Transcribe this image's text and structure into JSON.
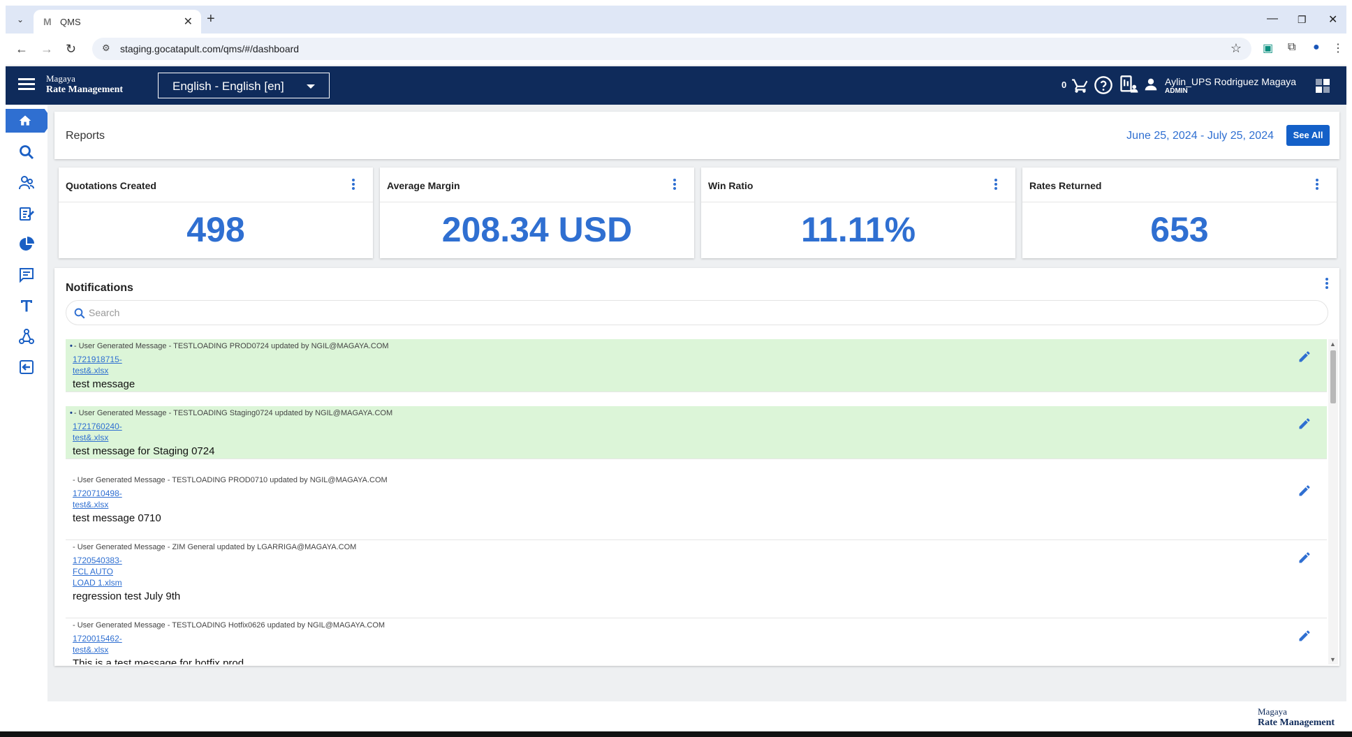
{
  "browser": {
    "tab_title": "QMS",
    "tab_favicon": "M",
    "url": "staging.gocatapult.com/qms/#/dashboard"
  },
  "header": {
    "brand_line1": "Magaya",
    "brand_line2": "Rate Management",
    "language": "English - English [en]",
    "cart_count": "0",
    "user_name": "Aylin_UPS Rodriguez Magaya",
    "user_role": "ADMIN"
  },
  "sidebar": {
    "items": [
      "home-icon",
      "search-icon",
      "users-icon",
      "edit-document-icon",
      "pie-chart-icon",
      "message-icon",
      "text-icon",
      "network-icon",
      "logout-icon"
    ]
  },
  "reports": {
    "title": "Reports",
    "date_range": "June 25, 2024 - July 25, 2024",
    "see_all_label": "See All"
  },
  "stats": [
    {
      "title": "Quotations Created",
      "value": "498"
    },
    {
      "title": "Average Margin",
      "value": "208.34 USD"
    },
    {
      "title": "Win Ratio",
      "value": "11.11%"
    },
    {
      "title": "Rates Returned",
      "value": "653"
    }
  ],
  "notifications": {
    "title": "Notifications",
    "search_placeholder": "Search",
    "items": [
      {
        "unread": true,
        "meta": "- User Generated Message - TESTLOADING PROD0724 updated by NGIL@MAGAYA.COM",
        "link_lines": [
          "1721918715-",
          "test&.xlsx"
        ],
        "message": "test message"
      },
      {
        "unread": true,
        "meta": "- User Generated Message - TESTLOADING Staging0724 updated by NGIL@MAGAYA.COM",
        "link_lines": [
          "1721760240-",
          "test&.xlsx"
        ],
        "message": "test message for Staging 0724"
      },
      {
        "unread": false,
        "meta": "- User Generated Message - TESTLOADING PROD0710 updated by NGIL@MAGAYA.COM",
        "link_lines": [
          "1720710498-",
          "test&.xlsx"
        ],
        "message": "test message 0710"
      },
      {
        "unread": false,
        "meta": "- User Generated Message - ZIM General updated by LGARRIGA@MAGAYA.COM",
        "link_lines": [
          "1720540383-",
          "FCL AUTO",
          "LOAD 1.xlsm"
        ],
        "message": "regression test July 9th"
      },
      {
        "unread": false,
        "meta": "- User Generated Message - TESTLOADING Hotfix0626 updated by NGIL@MAGAYA.COM",
        "link_lines": [
          "1720015462-",
          "test&.xlsx"
        ],
        "message": "This is a test message for hotfix prod."
      }
    ]
  },
  "footer": {
    "brand_line1": "Magaya",
    "brand_line2": "Rate Management"
  },
  "colors": {
    "header_bg": "#0f2b5b",
    "accent": "#2f6fd1",
    "unread_bg": "#dcf5d8"
  }
}
